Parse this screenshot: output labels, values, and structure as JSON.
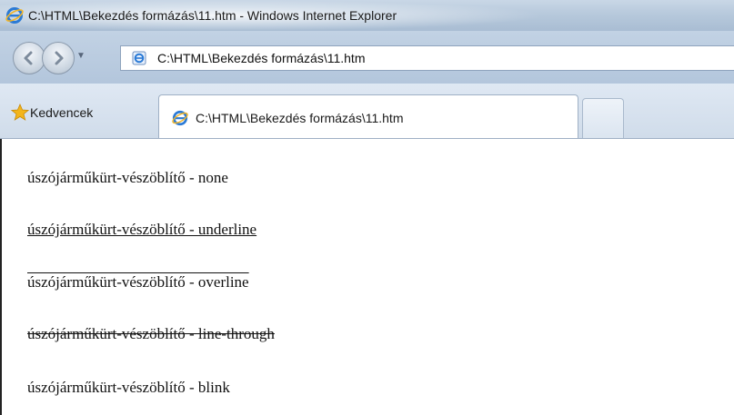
{
  "window": {
    "title": "C:\\HTML\\Bekezdés formázás\\11.htm - Windows Internet Explorer"
  },
  "navigation": {
    "address": "C:\\HTML\\Bekezdés formázás\\11.htm"
  },
  "favorites": {
    "label": "Kedvencek"
  },
  "tabs": [
    {
      "label": "C:\\HTML\\Bekezdés formázás\\11.htm"
    }
  ],
  "content": {
    "lines": [
      "úszójárműkürt-vészöblítő - none",
      "úszójárműkürt-vészöblítő - underline",
      "úszójárműkürt-vészöblítő - overline",
      "úszójárműkürt-vészöblítő - line-through",
      "úszójárműkürt-vészöblítő - blink"
    ]
  },
  "icons": {
    "title": "ie-logo-icon",
    "back": "back-arrow-icon",
    "forward": "forward-arrow-icon",
    "page": "ie-page-icon",
    "favorites": "favorites-star-icon",
    "tab": "ie-logo-icon"
  }
}
